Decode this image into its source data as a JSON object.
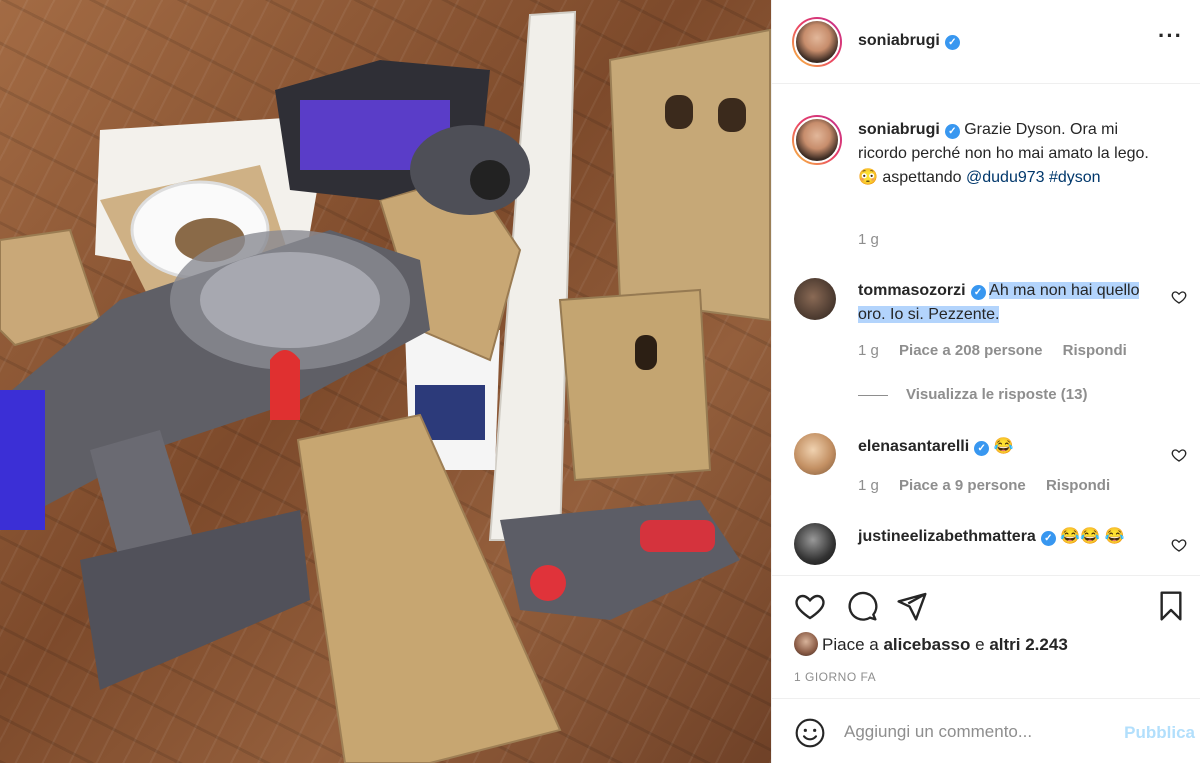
{
  "photo": {
    "alt_icon": "vacuum-photo"
  },
  "header": {
    "username": "soniabrugi",
    "more_icon": "more-icon"
  },
  "caption": {
    "username": "soniabrugi",
    "text_before": "Grazie Dyson. Ora mi ricordo perché non ho mai amato la lego. 😳 aspettando ",
    "mention": "@dudu973",
    "hashtag": "#dyson",
    "time": "1 g"
  },
  "comments": [
    {
      "username": "tommasozorzi",
      "text": "Ah ma non hai quello oro. Io si. Pezzente.",
      "time": "1 g",
      "likes": "Piace a 208 persone",
      "reply": "Rispondi",
      "view_replies": "Visualizza le risposte (13)"
    },
    {
      "username": "elenasantarelli",
      "text": "😂",
      "time": "1 g",
      "likes": "Piace a 9 persone",
      "reply": "Rispondi"
    },
    {
      "username": "justineelizabethmattera",
      "text": "😂😂 😂"
    }
  ],
  "actions": {
    "like_icon": "heart-icon",
    "comment_icon": "comment-icon",
    "share_icon": "share-icon",
    "save_icon": "bookmark-icon"
  },
  "likes": {
    "prefix": "Piace a",
    "user": "alicebasso",
    "middle": "e",
    "others": "altri 2.243"
  },
  "date": "1 GIORNO FA",
  "composer": {
    "emoji_icon": "emoji-icon",
    "placeholder": "Aggiungi un commento...",
    "publish": "Pubblica"
  },
  "colors": {
    "verified": "#3897f0",
    "link": "#00376b",
    "muted": "#8e8e8e",
    "publish_disabled": "#b2dffc",
    "selection": "#b3d4fc"
  }
}
